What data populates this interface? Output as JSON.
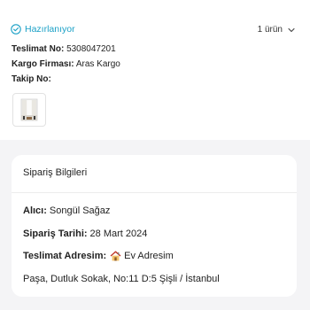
{
  "order": {
    "status": "Hazırlanıyor",
    "item_count": "1 ürün",
    "delivery_no_label": "Teslimat No:",
    "delivery_no": "5308047201",
    "cargo_label": "Kargo Firması:",
    "cargo_company": "Aras Kargo",
    "tracking_label": "Takip No:",
    "tracking_no": ""
  },
  "details": {
    "title": "Sipariş Bilgileri",
    "buyer_label": "Alıcı:",
    "buyer": "Songül Sağaz",
    "date_label": "Sipariş Tarihi:",
    "date": "28 Mart 2024",
    "address_label": "Teslimat Adresim:",
    "address_name": "Ev Adresim",
    "address": "Paşa, Dutluk Sokak, No:11 D:5 Şişli / İstanbul"
  },
  "colors": {
    "status": "#1aa0c6",
    "background": "#f4f4f6",
    "card": "#ffffff"
  },
  "icons": {
    "status": "check-circle-icon",
    "expand": "chevron-down-icon",
    "address": "house-icon"
  }
}
